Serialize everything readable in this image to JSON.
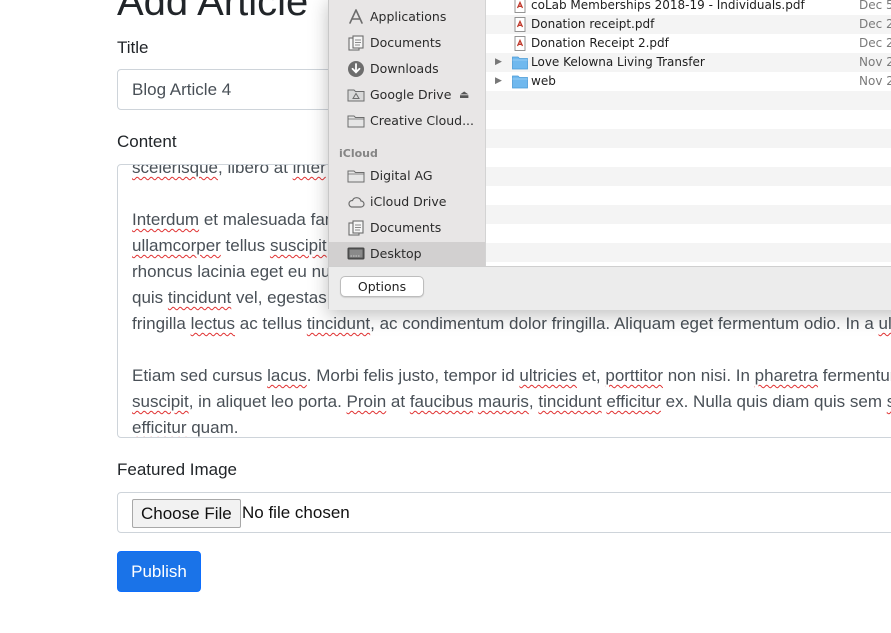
{
  "form": {
    "heading": "Add Article",
    "title_label": "Title",
    "title_value": "Blog Article 4",
    "content_label": "Content",
    "content_lines": [
      [
        {
          "t": "scelerisque",
          "sp": true
        },
        {
          "t": ", libero at "
        },
        {
          "t": "inter",
          "sp": true
        }
      ],
      [
        {
          "t": ""
        }
      ],
      [
        {
          "t": "Interdum",
          "sp": true
        },
        {
          "t": " et malesuada fam"
        }
      ],
      [
        {
          "t": "ullamcorper",
          "sp": true
        },
        {
          "t": " tellus "
        },
        {
          "t": "suscipit",
          "sp": true
        }
      ],
      [
        {
          "t": "rhoncus lacinia eget eu nun"
        }
      ],
      [
        {
          "t": "quis "
        },
        {
          "t": "tincidunt",
          "sp": true
        },
        {
          "t": " vel, egestas"
        }
      ],
      [
        {
          "t": "fringilla "
        },
        {
          "t": "lectus",
          "sp": true
        },
        {
          "t": " ac tellus "
        },
        {
          "t": "tincidunt",
          "sp": true
        },
        {
          "t": ", ac condimentum dolor fringilla. Aliquam eget fermentum odio. In a "
        },
        {
          "t": "ult",
          "sp": true
        }
      ],
      [
        {
          "t": ""
        }
      ],
      [
        {
          "t": "Etiam sed cursus "
        },
        {
          "t": "lacus",
          "sp": true
        },
        {
          "t": ". Morbi felis justo, tempor id "
        },
        {
          "t": "ultricies",
          "sp": true
        },
        {
          "t": " et, "
        },
        {
          "t": "porttitor",
          "sp": true
        },
        {
          "t": " non nisi. In "
        },
        {
          "t": "pharetra",
          "sp": true
        },
        {
          "t": " fermentum"
        }
      ],
      [
        {
          "t": "suscipit",
          "sp": true
        },
        {
          "t": ", in aliquet leo porta. "
        },
        {
          "t": "Proin",
          "sp": true
        },
        {
          "t": " at "
        },
        {
          "t": "faucibus",
          "sp": true
        },
        {
          "t": " "
        },
        {
          "t": "mauris",
          "sp": true
        },
        {
          "t": ", "
        },
        {
          "t": "tincidunt",
          "sp": true
        },
        {
          "t": " "
        },
        {
          "t": "efficitur",
          "sp": true
        },
        {
          "t": " ex. Nulla quis diam quis sem "
        },
        {
          "t": "sc",
          "sp": true
        }
      ],
      [
        {
          "t": "efficitur",
          "sp": true
        },
        {
          "t": " quam."
        }
      ]
    ],
    "featured_label": "Featured Image",
    "choose_file_label": "Choose File",
    "no_file_text": "No file chosen",
    "publish_label": "Publish",
    "accent_color": "#1a73e8"
  },
  "dialog": {
    "favorites": [
      {
        "label": "Applications",
        "icon": "applications-icon"
      },
      {
        "label": "Documents",
        "icon": "documents-icon"
      },
      {
        "label": "Downloads",
        "icon": "downloads-icon"
      },
      {
        "label": "Google Drive",
        "icon": "drive-icon",
        "eject": "⏏"
      },
      {
        "label": "Creative Cloud...",
        "icon": "folder-icon"
      }
    ],
    "icloud_header": "iCloud",
    "icloud": [
      {
        "label": "Digital AG",
        "icon": "folder-icon"
      },
      {
        "label": "iCloud Drive",
        "icon": "cloud-icon"
      },
      {
        "label": "Documents",
        "icon": "documents-icon"
      },
      {
        "label": "Desktop",
        "icon": "desktop-icon",
        "selected": true
      }
    ],
    "files": [
      {
        "name": "coLab Memberships 2018-19 - Individuals.pdf",
        "date": "Dec 5",
        "kind": "pdf"
      },
      {
        "name": "Donation receipt.pdf",
        "date": "Dec 2",
        "kind": "pdf"
      },
      {
        "name": "Donation Receipt 2.pdf",
        "date": "Dec 2",
        "kind": "pdf"
      },
      {
        "name": "Love Kelowna Living Transfer",
        "date": "Nov 2",
        "kind": "folder"
      },
      {
        "name": "web",
        "date": "Nov 2",
        "kind": "folder"
      }
    ],
    "options_label": "Options"
  }
}
